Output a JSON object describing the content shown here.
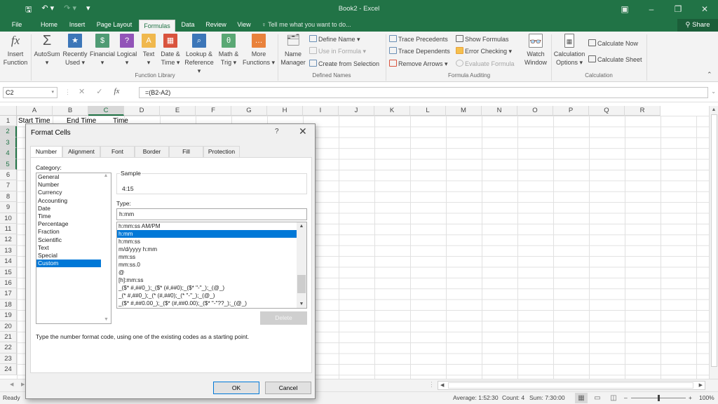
{
  "window": {
    "title": "Book2 - Excel",
    "qat": {
      "save_icon": "save-icon",
      "undo_icon": "undo-icon",
      "redo_icon": "redo-icon",
      "customize_icon": "customize-qat-icon"
    },
    "controls": {
      "ribbon_display": "▣",
      "minimize": "–",
      "restore": "❐",
      "close": "✕"
    }
  },
  "tabs": [
    {
      "label": "File"
    },
    {
      "label": "Home"
    },
    {
      "label": "Insert"
    },
    {
      "label": "Page Layout"
    },
    {
      "label": "Formulas",
      "active": true
    },
    {
      "label": "Data"
    },
    {
      "label": "Review"
    },
    {
      "label": "View"
    }
  ],
  "tell_me": "Tell me what you want to do...",
  "share_label": "Share",
  "ribbon": {
    "function_library": {
      "label": "Function Library",
      "buttons": [
        {
          "line1": "Insert",
          "line2": "Function",
          "icon": "fx"
        },
        {
          "line1": "AutoSum",
          "line2": "▾",
          "icon": "Σ"
        },
        {
          "line1": "Recently",
          "line2": "Used ▾",
          "icon": "★"
        },
        {
          "line1": "Financial",
          "line2": "▾",
          "icon": "$"
        },
        {
          "line1": "Logical",
          "line2": "▾",
          "icon": "?"
        },
        {
          "line1": "Text",
          "line2": "▾",
          "icon": "A"
        },
        {
          "line1": "Date &",
          "line2": "Time ▾",
          "icon": "▦"
        },
        {
          "line1": "Lookup &",
          "line2": "Reference ▾",
          "icon": "⌕"
        },
        {
          "line1": "Math &",
          "line2": "Trig ▾",
          "icon": "θ"
        },
        {
          "line1": "More",
          "line2": "Functions ▾",
          "icon": "…"
        }
      ]
    },
    "defined_names": {
      "label": "Defined Names",
      "name_manager": {
        "line1": "Name",
        "line2": "Manager"
      },
      "define_name": "Define Name ▾",
      "use_in_formula": "Use in Formula ▾",
      "create_from_selection": "Create from Selection"
    },
    "formula_auditing": {
      "label": "Formula Auditing",
      "trace_precedents": "Trace Precedents",
      "trace_dependents": "Trace Dependents",
      "remove_arrows": "Remove Arrows ▾",
      "show_formulas": "Show Formulas",
      "error_checking": "Error Checking ▾",
      "evaluate_formula": "Evaluate Formula",
      "watch_window": {
        "line1": "Watch",
        "line2": "Window"
      }
    },
    "calculation": {
      "label": "Calculation",
      "options": {
        "line1": "Calculation",
        "line2": "Options ▾"
      },
      "calculate_now": "Calculate Now",
      "calculate_sheet": "Calculate Sheet"
    },
    "collapse": "⌃"
  },
  "formula_bar": {
    "name_box": "C2",
    "cancel": "✕",
    "enter": "✓",
    "fx": "fx",
    "formula": "=(B2-A2)"
  },
  "columns": [
    "A",
    "B",
    "C",
    "D",
    "E",
    "F",
    "G",
    "H",
    "I",
    "J",
    "K",
    "L",
    "M",
    "N",
    "O",
    "P",
    "Q",
    "R"
  ],
  "rows": [
    "1",
    "2",
    "3",
    "4",
    "5",
    "6",
    "7",
    "8",
    "9",
    "10",
    "11",
    "12",
    "13",
    "14",
    "15",
    "16",
    "17",
    "18",
    "19",
    "20",
    "21",
    "22",
    "23",
    "24"
  ],
  "cells": {
    "A1": "Start Time",
    "B1": "End Time",
    "C1": "Time"
  },
  "dialog": {
    "title": "Format Cells",
    "help": "?",
    "close": "✕",
    "tabs": [
      "Number",
      "Alignment",
      "Font",
      "Border",
      "Fill",
      "Protection"
    ],
    "category_label": "Category:",
    "categories": [
      "General",
      "Number",
      "Currency",
      "Accounting",
      "Date",
      "Time",
      "Percentage",
      "Fraction",
      "Scientific",
      "Text",
      "Special",
      "Custom"
    ],
    "selected_category": "Custom",
    "sample_label": "Sample",
    "sample_value": "4:15",
    "type_label": "Type:",
    "type_value": "h:mm",
    "type_list": [
      "h:mm:ss AM/PM",
      "h:mm",
      "h:mm:ss",
      "m/d/yyyy h:mm",
      "mm:ss",
      "mm:ss.0",
      "@",
      "[h]:mm:ss",
      "_($* #,##0_);_($* (#,##0);_($* \"-\"_);_(@_)",
      "_(* #,##0_);_(* (#,##0);_(* \"-\"_);_(@_)",
      "_($* #,##0.00_);_($* (#,##0.00);_($* \"-\"??_);_(@_)"
    ],
    "selected_type": "h:mm",
    "delete_label": "Delete",
    "hint": "Type the number format code, using one of the existing codes as a starting point.",
    "ok_label": "OK",
    "cancel_label": "Cancel"
  },
  "status": {
    "ready": "Ready",
    "average": "Average: 1:52:30",
    "count": "Count: 4",
    "sum": "Sum: 7:30:00",
    "zoom": "100%",
    "zoom_minus": "–",
    "zoom_plus": "+"
  }
}
